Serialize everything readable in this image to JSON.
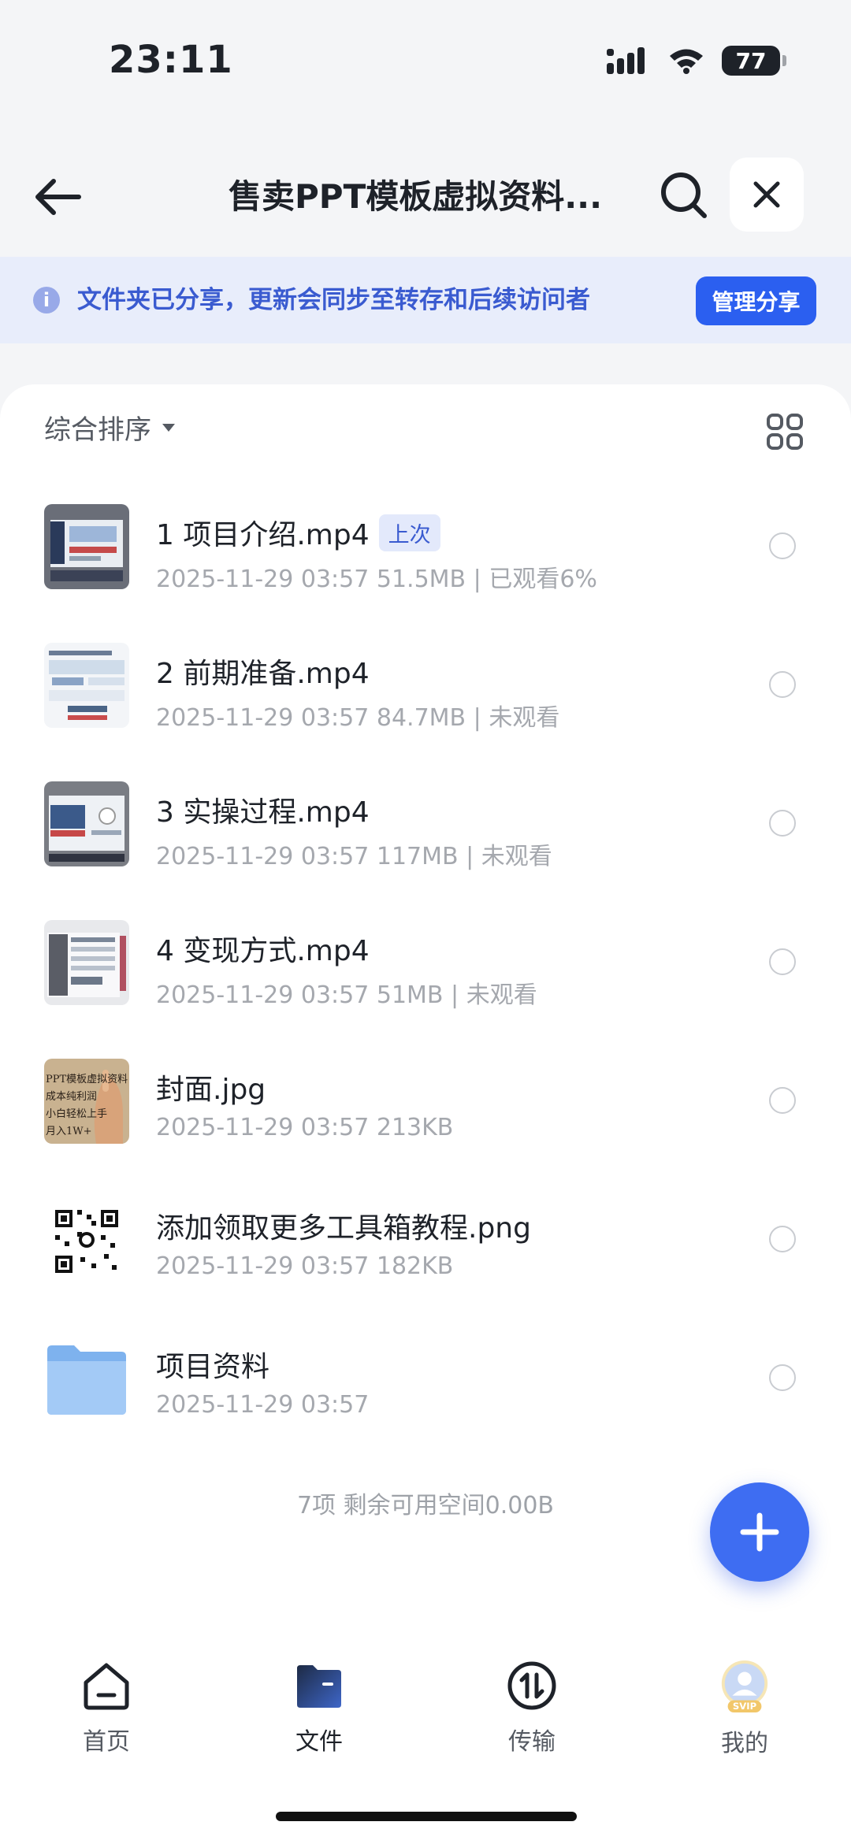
{
  "status_bar": {
    "time": "23:11",
    "battery": "77"
  },
  "nav": {
    "title": "售卖PPT模板虚拟资料...",
    "back_icon": "arrow-left-icon",
    "search_icon": "search-icon",
    "close_icon": "close-icon"
  },
  "share_banner": {
    "text": "文件夹已分享，更新会同步至转存和后续访问者",
    "button": "管理分享"
  },
  "sort": {
    "label": "综合排序"
  },
  "files": [
    {
      "name": "1 项目介绍.mp4",
      "badge": "上次",
      "meta": "2025-11-29 03:57  51.5MB | 已观看6%",
      "thumb": "video"
    },
    {
      "name": "2 前期准备.mp4",
      "badge": "",
      "meta": "2025-11-29 03:57  84.7MB | 未观看",
      "thumb": "video"
    },
    {
      "name": "3 实操过程.mp4",
      "badge": "",
      "meta": "2025-11-29 03:57  117MB | 未观看",
      "thumb": "video"
    },
    {
      "name": "4 变现方式.mp4",
      "badge": "",
      "meta": "2025-11-29 03:57  51MB | 未观看",
      "thumb": "video"
    },
    {
      "name": "封面.jpg",
      "badge": "",
      "meta": "2025-11-29 03:57  213KB",
      "thumb": "image"
    },
    {
      "name": "添加领取更多工具箱教程.png",
      "badge": "",
      "meta": "2025-11-29 03:57  182KB",
      "thumb": "qr"
    },
    {
      "name": "项目资料",
      "badge": "",
      "meta": "2025-11-29 03:57",
      "thumb": "folder"
    }
  ],
  "cover_text": {
    "line1": "PPT模板虚拟资料",
    "line2": "成本纯利润",
    "line3": "小白轻松上手",
    "line4": "月入1W+"
  },
  "footer": {
    "count": "7项 剩余可用空间0.00B"
  },
  "tabs": [
    {
      "label": "首页",
      "icon": "home-icon",
      "active": false
    },
    {
      "label": "文件",
      "icon": "folder-icon",
      "active": true
    },
    {
      "label": "传输",
      "icon": "transfer-icon",
      "active": false
    },
    {
      "label": "我的",
      "icon": "avatar-icon",
      "active": false
    }
  ],
  "svip_badge": "SVIP",
  "colors": {
    "accent": "#2b5ff0",
    "banner_bg": "#e8edfb",
    "banner_text": "#3a5bd0"
  }
}
